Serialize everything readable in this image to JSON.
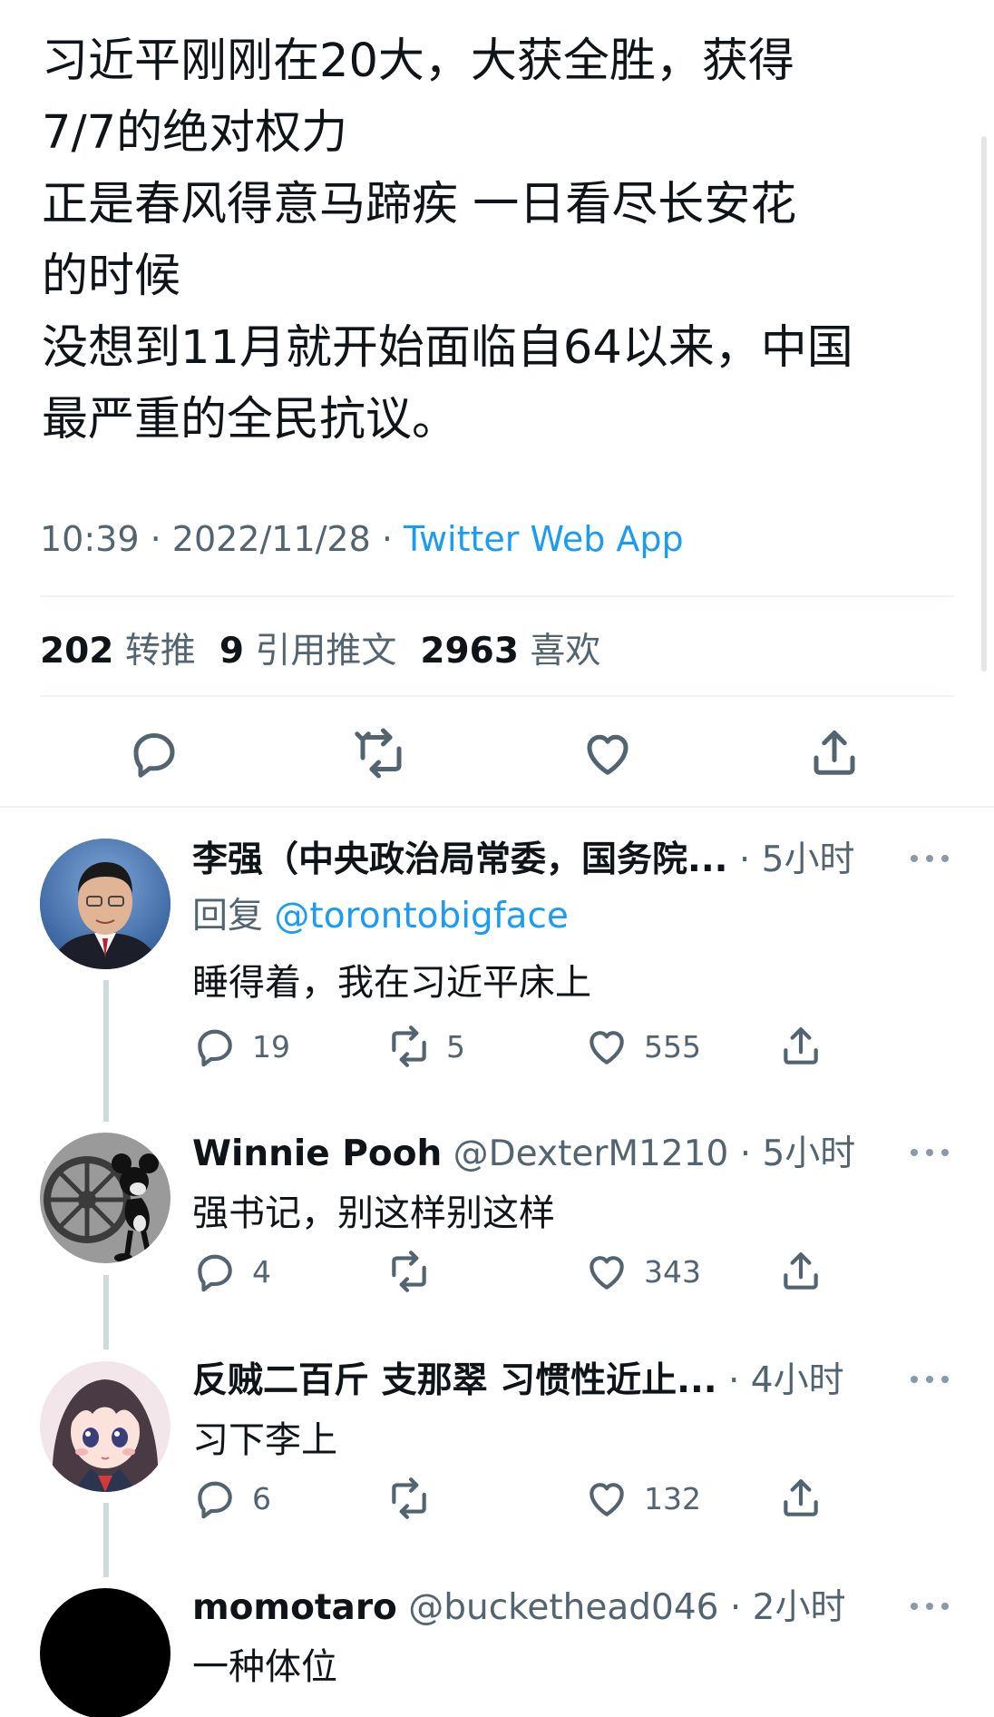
{
  "tweet": {
    "lines": [
      "习近平刚刚在20大，大获全胜，获得",
      "7/7的绝对权力",
      "正是春风得意马蹄疾 一日看尽长安花",
      "的时候",
      "没想到11月就开始面临自64以来，中国",
      "最严重的全民抗议。"
    ],
    "time": "10:39",
    "sep": " · ",
    "date": "2022/11/28",
    "source": "Twitter Web App",
    "stats": {
      "retweets_count": "202",
      "retweets_label": "转推",
      "quotes_count": "9",
      "quotes_label": "引用推文",
      "likes_count": "2963",
      "likes_label": "喜欢"
    }
  },
  "replies": [
    {
      "name": "李强（中央政治局常委，国务院...",
      "handle": "",
      "time": " · 5小时",
      "reply_prefix": "回复 ",
      "reply_to": "@torontobigface",
      "text": "睡得着，我在习近平床上",
      "replies": "19",
      "retweets": "5",
      "likes": "555"
    },
    {
      "name": "Winnie Pooh",
      "handle": " @DexterM1210",
      "time": " · 5小时",
      "text": "强书记，别这样别这样",
      "replies": "4",
      "retweets": "",
      "likes": "343"
    },
    {
      "name": "反贼二百斤 支那翠 习惯性近止...",
      "handle": "",
      "time": " · 4小时",
      "text": "习下李上",
      "replies": "6",
      "retweets": "",
      "likes": "132"
    },
    {
      "name": "momotaro",
      "handle": " @buckethead046",
      "time": " · 2小时",
      "text": "一种体位"
    }
  ],
  "colors": {
    "text": "#0f1419",
    "secondary": "#536471",
    "link": "#1d9bf0",
    "divider": "#eff3f4"
  }
}
